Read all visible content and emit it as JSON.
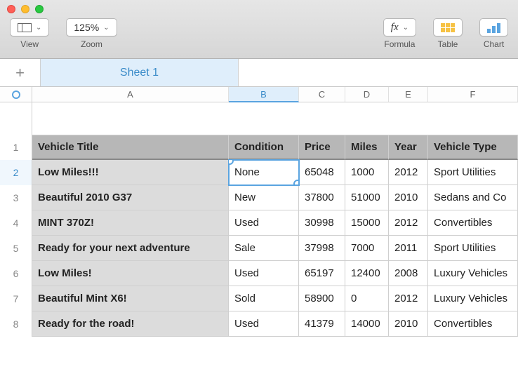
{
  "toolbar": {
    "view_label": "View",
    "zoom_value": "125%",
    "zoom_label": "Zoom",
    "formula_label": "Formula",
    "table_label": "Table",
    "chart_label": "Chart"
  },
  "sheet_tab": "Sheet 1",
  "columns": {
    "A": "A",
    "B": "B",
    "C": "C",
    "D": "D",
    "E": "E",
    "F": "F"
  },
  "row_nums": {
    "r1": "1",
    "r2": "2",
    "r3": "3",
    "r4": "4",
    "r5": "5",
    "r6": "6",
    "r7": "7",
    "r8": "8"
  },
  "headers": {
    "title": "Vehicle Title",
    "condition": "Condition",
    "price": "Price",
    "miles": "Miles",
    "year": "Year",
    "type": "Vehicle Type"
  },
  "rows": {
    "r2": {
      "title": "Low Miles!!!",
      "condition": "None",
      "price": "65048",
      "miles": "1000",
      "year": "2012",
      "type": "Sport Utilities"
    },
    "r3": {
      "title": "Beautiful 2010 G37",
      "condition": "New",
      "price": "37800",
      "miles": "51000",
      "year": "2010",
      "type": "Sedans and Co"
    },
    "r4": {
      "title": "MINT 370Z!",
      "condition": "Used",
      "price": "30998",
      "miles": "15000",
      "year": "2012",
      "type": "Convertibles"
    },
    "r5": {
      "title": "Ready for your next adventure",
      "condition": "Sale",
      "price": "37998",
      "miles": "7000",
      "year": "2011",
      "type": "Sport Utilities"
    },
    "r6": {
      "title": "Low Miles!",
      "condition": "Used",
      "price": "65197",
      "miles": "12400",
      "year": "2008",
      "type": "Luxury Vehicles"
    },
    "r7": {
      "title": "Beautiful Mint X6!",
      "condition": "Sold",
      "price": "58900",
      "miles": "0",
      "year": "2012",
      "type": "Luxury Vehicles"
    },
    "r8": {
      "title": "Ready for the road!",
      "condition": "Used",
      "price": "41379",
      "miles": "14000",
      "year": "2010",
      "type": "Convertibles"
    }
  },
  "selected": {
    "col": "B",
    "row": "2"
  }
}
